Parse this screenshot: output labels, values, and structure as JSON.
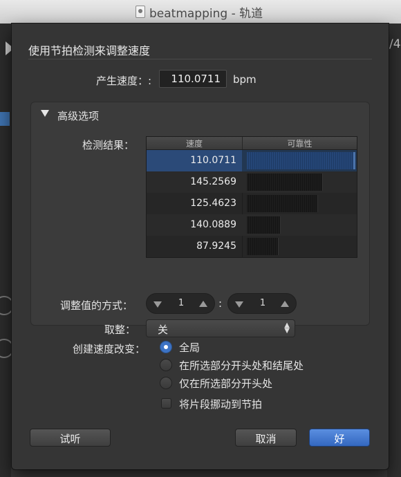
{
  "window": {
    "title": "beatmapping - 轨道",
    "right_peek": "/4"
  },
  "dialog": {
    "title": "使用节拍检测来调整速度",
    "tempo": {
      "label": "产生速度：:",
      "value": "110.0711",
      "unit": "bpm"
    },
    "advanced": {
      "title": "高级选项",
      "expanded": true,
      "results_label": "检测结果：",
      "columns": [
        "速度",
        "可靠性"
      ],
      "rows": [
        {
          "tempo": "110.0711",
          "confidence": 1.0,
          "selected": true
        },
        {
          "tempo": "145.2569",
          "confidence": 0.71,
          "selected": false
        },
        {
          "tempo": "125.4623",
          "confidence": 0.66,
          "selected": false
        },
        {
          "tempo": "140.0889",
          "confidence": 0.31,
          "selected": false
        },
        {
          "tempo": "87.9245",
          "confidence": 0.29,
          "selected": false
        }
      ],
      "adjust_label": "调整值的方式：",
      "stepper_a": "1",
      "stepper_sep": ":",
      "stepper_b": "1",
      "round_label": "取整：",
      "round_value": "关"
    },
    "create_label": "创建速度改变：",
    "radios": [
      {
        "label": "全局",
        "checked": true
      },
      {
        "label": "在所选部分开头处和结尾处",
        "checked": false
      },
      {
        "label": "仅在所选部分开头处",
        "checked": false
      }
    ],
    "checkbox": {
      "label": "将片段挪动到节拍",
      "checked": false
    },
    "buttons": {
      "listen": "试听",
      "cancel": "取消",
      "ok": "好"
    }
  },
  "colors": {
    "accent": "#3d73c4",
    "selection": "#2b4a78",
    "sheet_bg": "#353535"
  }
}
